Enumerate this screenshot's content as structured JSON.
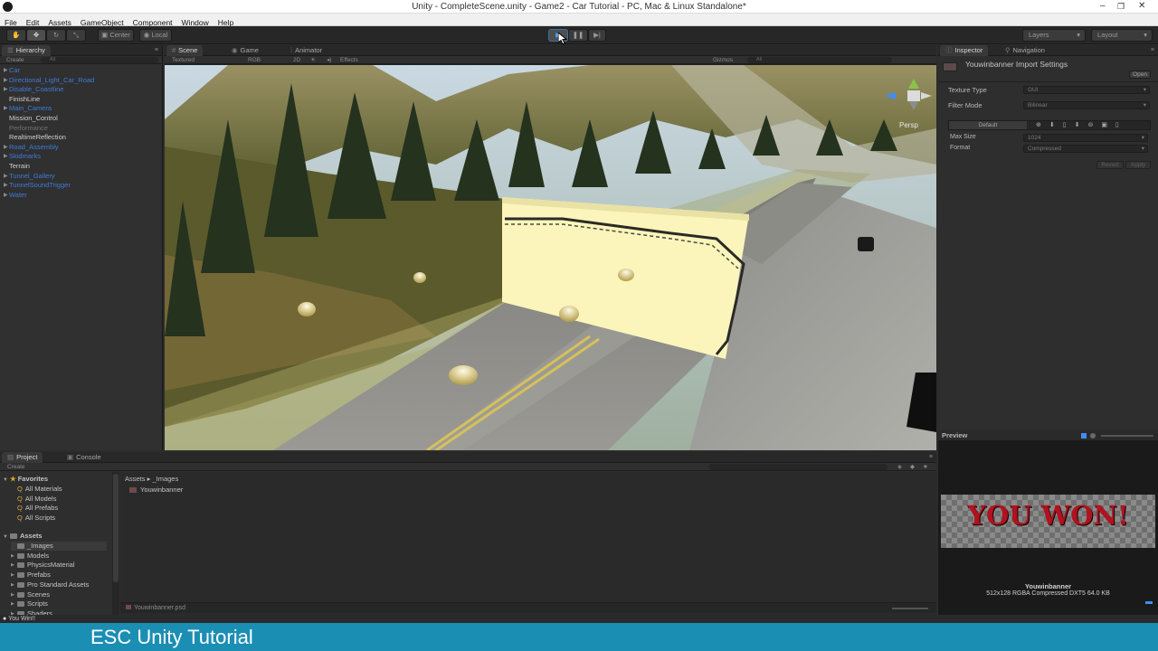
{
  "window": {
    "title": "Unity - CompleteScene.unity - Game2 - Car Tutorial - PC, Mac & Linux Standalone*",
    "minimize": "–",
    "maximize": "❐",
    "close": "✕"
  },
  "menu": [
    "File",
    "Edit",
    "Assets",
    "GameObject",
    "Component",
    "Window",
    "Help"
  ],
  "toolbar": {
    "pivot_label": "Center",
    "space_label": "Local",
    "play_icon": "▶",
    "pause_icon": "❚❚",
    "step_icon": "▶|",
    "layers_label": "Layers",
    "layout_label": "Layout"
  },
  "hierarchy": {
    "tab_label": "Hierarchy",
    "create_label": "Create",
    "search_placeholder": "All",
    "items": [
      {
        "label": "Car",
        "color": "blue"
      },
      {
        "label": "Directional_Light_Car_Road",
        "color": "blue"
      },
      {
        "label": "Disable_Coastline",
        "color": "blue"
      },
      {
        "label": "FinishLine",
        "color": "white"
      },
      {
        "label": "Main_Camera",
        "color": "blue"
      },
      {
        "label": "Mission_Control",
        "color": "white"
      },
      {
        "label": "Performance",
        "color": "gray"
      },
      {
        "label": "RealtimeReflection",
        "color": "white"
      },
      {
        "label": "Road_Assembly",
        "color": "blue"
      },
      {
        "label": "Skidmarks",
        "color": "blue"
      },
      {
        "label": "Terrain",
        "color": "white"
      },
      {
        "label": "Tunnel_Gallery",
        "color": "blue"
      },
      {
        "label": "TunnelSoundTrigger",
        "color": "blue"
      },
      {
        "label": "Water",
        "color": "blue"
      }
    ]
  },
  "scene": {
    "tabs": [
      "Scene",
      "Game",
      "Animator"
    ],
    "render_mode": "Textured",
    "color_mode": "RGB",
    "mode_2d": "2D",
    "effects_label": "Effects",
    "gizmos_label": "Gizmos",
    "search_placeholder": "All",
    "persp_label": "Persp"
  },
  "inspector": {
    "tabs": [
      "Inspector",
      "Navigation"
    ],
    "asset_title": "Youwinbanner Import Settings",
    "open_label": "Open",
    "fields": [
      {
        "label": "Texture Type",
        "value": "GUI"
      },
      {
        "label": "Filter Mode",
        "value": "Bilinear"
      }
    ],
    "platform_default": "Default",
    "platform_fields": [
      {
        "label": "Max Size",
        "value": "1024"
      },
      {
        "label": "Format",
        "value": "Compressed"
      }
    ],
    "revert_label": "Revert",
    "apply_label": "Apply"
  },
  "preview": {
    "header": "Preview",
    "image_text": "YOU WON!",
    "name": "Youwinbanner",
    "info": "512x128  RGBA Compressed DXT5   64.0 KB"
  },
  "project": {
    "tabs": [
      "Project",
      "Console"
    ],
    "create_label": "Create",
    "favorites_label": "Favorites",
    "favorites": [
      "All Materials",
      "All Models",
      "All Prefabs",
      "All Scripts"
    ],
    "assets_label": "Assets",
    "folders": [
      "_Images",
      "Models",
      "PhysicsMaterial",
      "Prefabs",
      "Pro Standard Assets",
      "Scenes",
      "Scripts",
      "Shaders"
    ],
    "breadcrumb": "Assets ▸ _Images",
    "files": [
      "Youwinbanner"
    ],
    "selected_file": "Youwinbanner.psd"
  },
  "status": {
    "message": "You Win!!"
  },
  "banner": {
    "text": "ESC Unity Tutorial"
  }
}
